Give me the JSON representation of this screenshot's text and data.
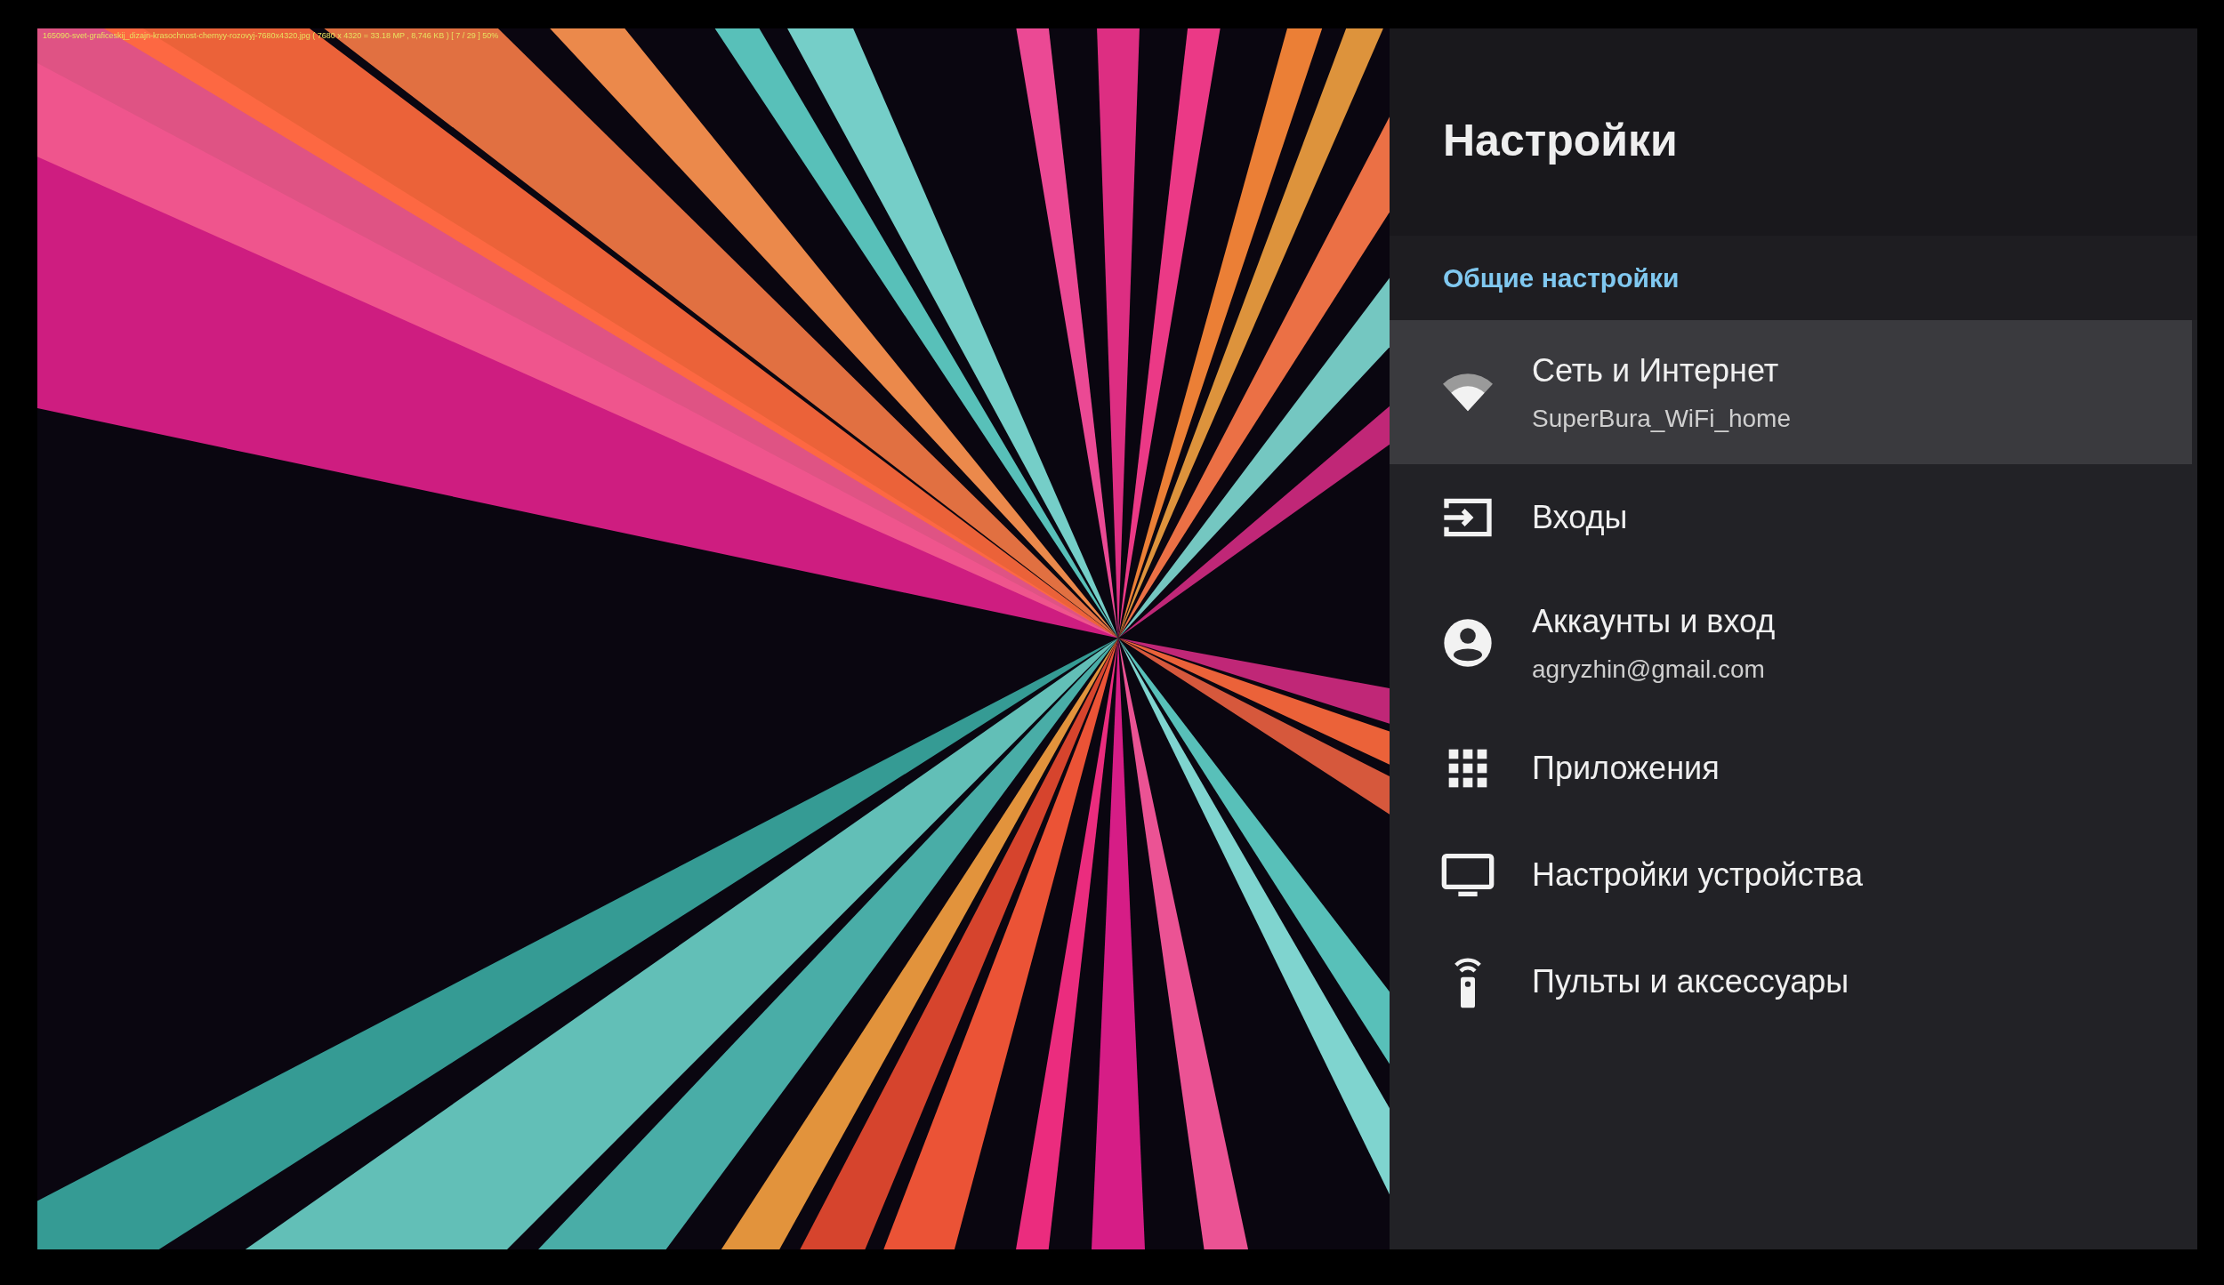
{
  "viewer_overlay": {
    "text": "165090-svet-graficeskij_dizajn-krasochnost-chernyy-rozovyj-7680x4320.jpg  ( 7680 x 4320 = 33.18 MP ,  8,746 KB )  [ 7 / 29 ]  50%"
  },
  "settings": {
    "title": "Настройки",
    "section": "Общие настройки",
    "items": [
      {
        "kind": "wifi",
        "label": "Сеть и Интернет",
        "subtitle": "SuperBura_WiFi_home",
        "selected": true
      },
      {
        "kind": "input",
        "label": "Входы",
        "selected": false
      },
      {
        "kind": "account",
        "label": "Аккаунты и вход",
        "subtitle": "agryzhin@gmail.com",
        "selected": false
      },
      {
        "kind": "apps",
        "label": "Приложения",
        "selected": false
      },
      {
        "kind": "tv",
        "label": "Настройки устройства",
        "selected": false
      },
      {
        "kind": "remote",
        "label": "Пульты и аксессуары",
        "selected": false
      }
    ]
  }
}
